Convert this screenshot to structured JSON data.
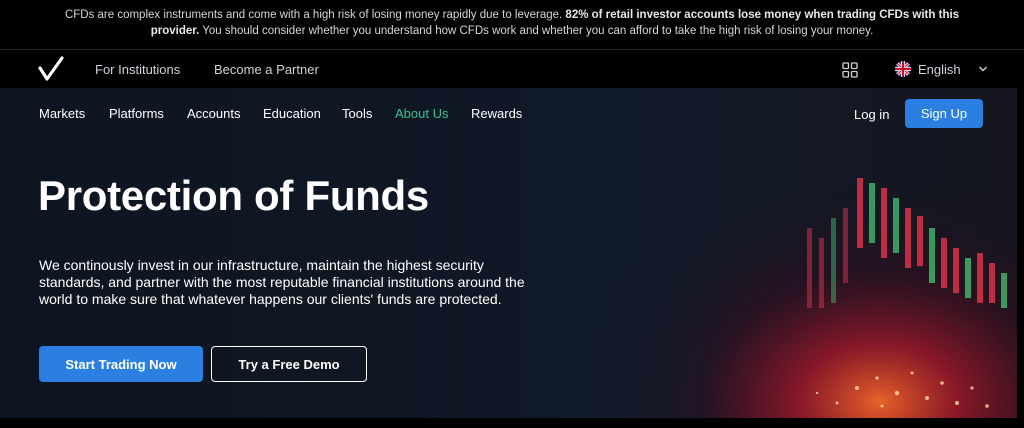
{
  "risk_warning": {
    "text_start": "CFDs are complex instruments and come with a high risk of losing money rapidly due to leverage. ",
    "text_bold": "82% of retail investor accounts lose money when trading CFDs with this provider.",
    "text_end": " You should consider whether you understand how CFDs work and whether you can afford to take the high risk of losing your money."
  },
  "topbar": {
    "links": [
      "For Institutions",
      "Become a Partner"
    ],
    "apps_icon": "grid-apps-icon",
    "language": "English",
    "flag_icon": "uk-flag-icon"
  },
  "nav": {
    "items": [
      {
        "label": "Markets"
      },
      {
        "label": "Platforms"
      },
      {
        "label": "Accounts"
      },
      {
        "label": "Education"
      },
      {
        "label": "Tools"
      },
      {
        "label": "About Us",
        "active": true
      },
      {
        "label": "Rewards"
      }
    ],
    "login": "Log in",
    "signup": "Sign Up"
  },
  "hero": {
    "title": "Protection of Funds",
    "description": "We continously invest in our infrastructure, maintain the highest security standards, and partner with the most reputable financial institutions around the world to make sure that whatever happens our clients' funds are protected.",
    "primary_cta": "Start Trading Now",
    "secondary_cta": "Try a Free Demo"
  },
  "colors": {
    "accent_blue": "#2a7fe0",
    "active_green": "#34c38f",
    "background": "#000000",
    "hero_background": "#0f1725"
  }
}
